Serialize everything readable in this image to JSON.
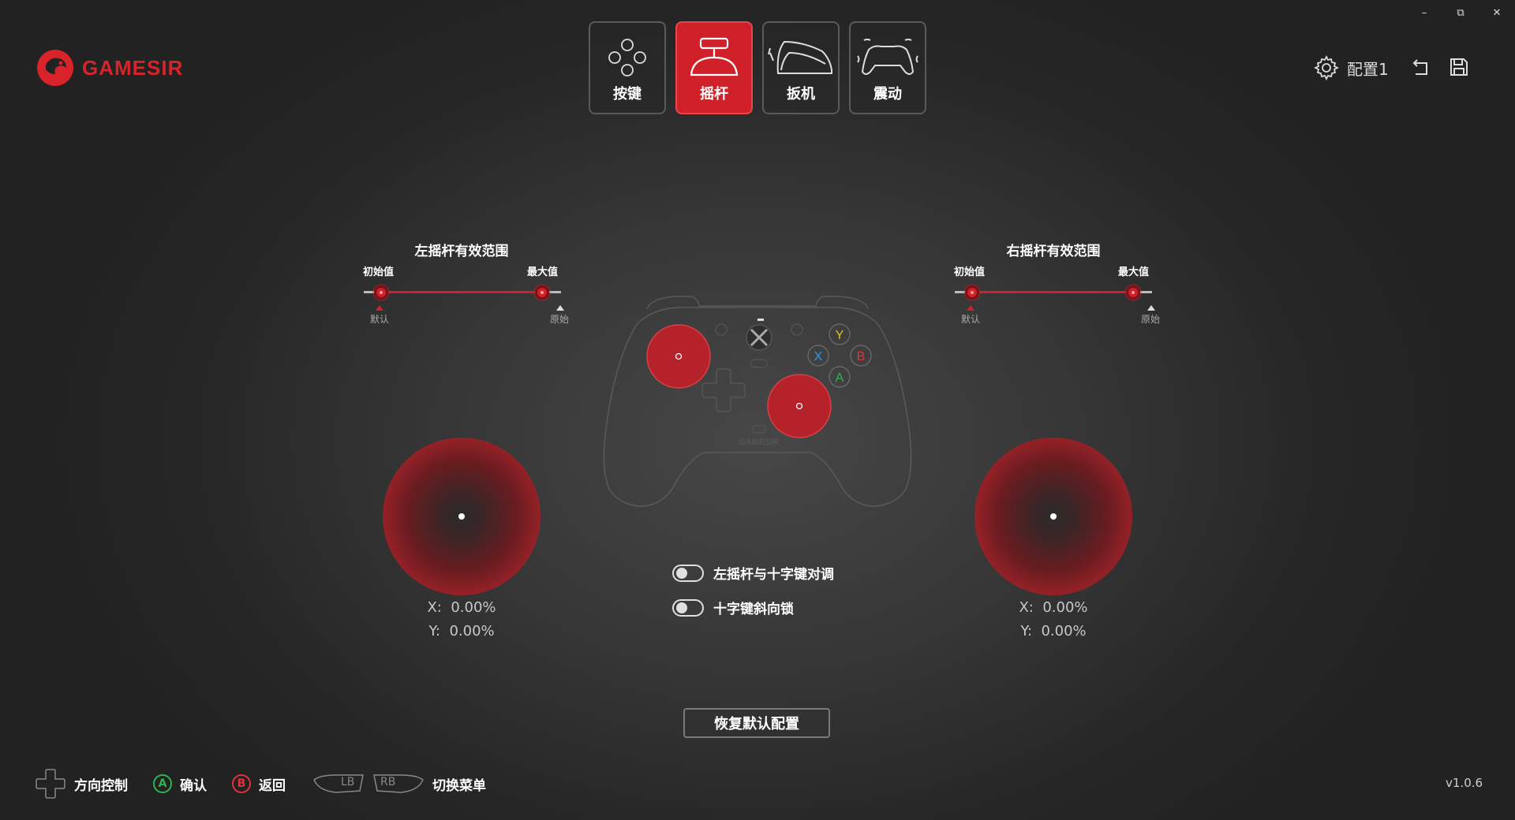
{
  "window": {
    "minimize": "–",
    "maximize": "⧉",
    "close": "✕"
  },
  "brand": {
    "name": "GAMESIR",
    "color": "#d8232a"
  },
  "tabs": [
    {
      "label": "按键",
      "icon": "buttons-icon",
      "active": false
    },
    {
      "label": "摇杆",
      "icon": "joystick-icon",
      "active": true
    },
    {
      "label": "扳机",
      "icon": "trigger-icon",
      "active": false
    },
    {
      "label": "震动",
      "icon": "vibration-icon",
      "active": false
    }
  ],
  "header": {
    "profile_label": "配置1"
  },
  "left_stick": {
    "title": "左摇杆有效范围",
    "min_label": "初始值",
    "max_label": "最大值",
    "min_marker": "默认",
    "max_marker": "原始",
    "x_label": "X:",
    "x_value": "0.00%",
    "y_label": "Y:",
    "y_value": "0.00%"
  },
  "right_stick": {
    "title": "右摇杆有效范围",
    "min_label": "初始值",
    "max_label": "最大值",
    "min_marker": "默认",
    "max_marker": "原始",
    "x_label": "X:",
    "x_value": "0.00%",
    "y_label": "Y:",
    "y_value": "0.00%"
  },
  "controller": {
    "brand_text": "GAMESIR",
    "face_buttons": {
      "y": "Y",
      "x": "X",
      "b": "B",
      "a": "A"
    },
    "button_colors": {
      "y": "#e6c21a",
      "x": "#2a9de0",
      "b": "#e0333a",
      "a": "#2fb54c"
    }
  },
  "toggles": [
    {
      "label": "左摇杆与十字键对调",
      "on": false
    },
    {
      "label": "十字键斜向锁",
      "on": false
    }
  ],
  "reset_label": "恢复默认配置",
  "footer": {
    "dpad_label": "方向控制",
    "a_key": "A",
    "a_label": "确认",
    "b_key": "B",
    "b_label": "返回",
    "lb_key": "LB",
    "rb_key": "RB",
    "switch_label": "切换菜单"
  },
  "version": "v1.0.6",
  "accent_color": "#d0202a"
}
